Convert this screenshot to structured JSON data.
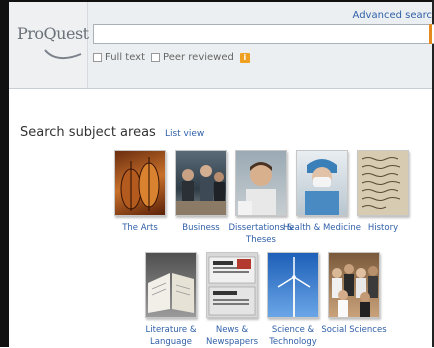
{
  "header": {
    "logo": "ProQuest",
    "advanced_link": "Advanced searc",
    "search": {
      "value": "",
      "placeholder": ""
    },
    "options": [
      {
        "label": "Full text",
        "checked": false
      },
      {
        "label": "Peer reviewed",
        "checked": false
      }
    ]
  },
  "subjects": {
    "heading": "Search subject areas",
    "list_view": "List view",
    "row1": [
      {
        "label": "The Arts",
        "image": "violins"
      },
      {
        "label": "Business",
        "image": "meeting"
      },
      {
        "label": "Dissertations & Theses",
        "image": "student"
      },
      {
        "label": "Health & Medicine",
        "image": "surgeon"
      },
      {
        "label": "History",
        "image": "manuscript"
      }
    ],
    "row2": [
      {
        "label": "Literature & Language",
        "image": "open-book"
      },
      {
        "label": "News & Newspapers",
        "image": "newspapers"
      },
      {
        "label": "Science & Technology",
        "image": "wind-turbine"
      },
      {
        "label": "Social Sciences",
        "image": "crowd"
      }
    ]
  },
  "colors": {
    "link": "#2f5fa8",
    "accent": "#e58a1f",
    "header_bg": "#eceff1"
  }
}
